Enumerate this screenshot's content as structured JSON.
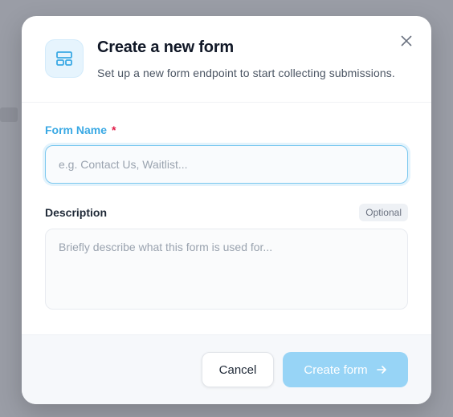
{
  "modal": {
    "title": "Create a new form",
    "subtitle": "Set up a new form endpoint to start collecting submissions.",
    "header_icon": "layout-template-icon",
    "close_icon": "close-icon"
  },
  "form": {
    "name_field": {
      "label": "Form Name",
      "required_marker": "*",
      "placeholder": "e.g. Contact Us, Waitlist...",
      "value": ""
    },
    "description_field": {
      "label": "Description",
      "badge": "Optional",
      "placeholder": "Briefly describe what this form is used for...",
      "value": ""
    }
  },
  "footer": {
    "cancel_label": "Cancel",
    "create_label": "Create form",
    "create_icon": "arrow-right-icon"
  },
  "colors": {
    "accent": "#3aa9e4",
    "create_button_disabled": "#97d4f6",
    "required": "#e11d48",
    "title_text": "#111827"
  }
}
